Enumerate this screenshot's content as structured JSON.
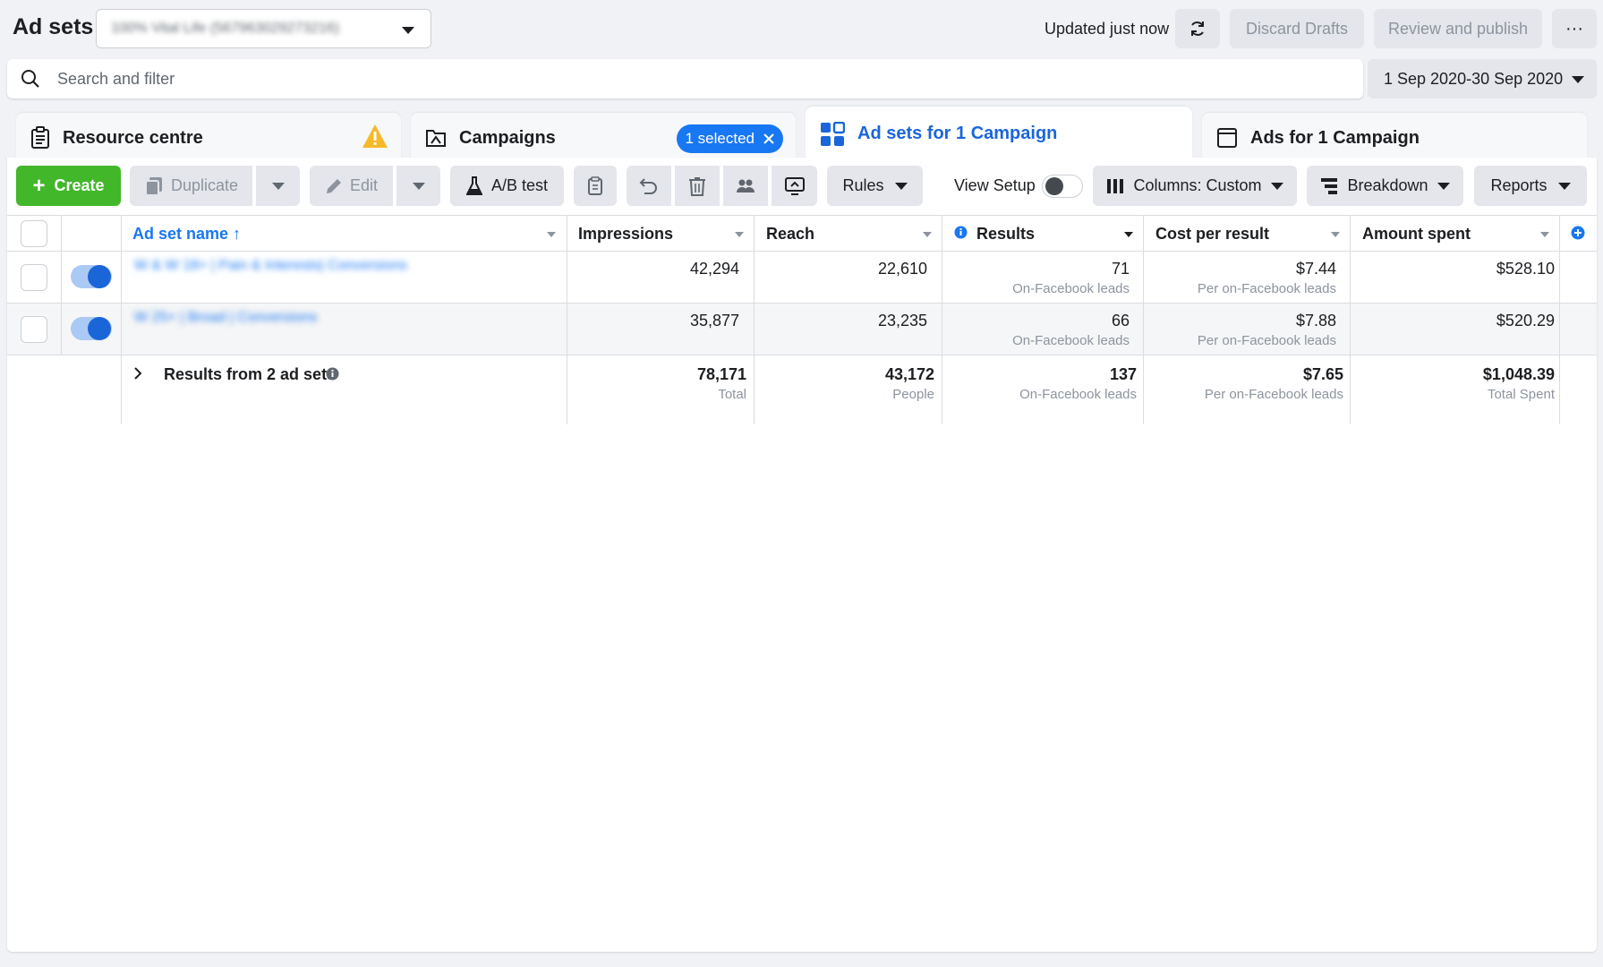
{
  "header": {
    "title": "Ad sets",
    "account_name": "100% Vital Life (567963029273216)",
    "updated_text": "Updated just now",
    "discard_label": "Discard Drafts",
    "publish_label": "Review and publish",
    "more_label": "···"
  },
  "search": {
    "placeholder": "Search and filter",
    "date_range": "1 Sep 2020-30 Sep 2020"
  },
  "tabs": [
    {
      "label": "Resource centre"
    },
    {
      "label": "Campaigns",
      "badge": "1 selected"
    },
    {
      "label": "Ad sets for 1 Campaign"
    },
    {
      "label": "Ads for 1 Campaign"
    }
  ],
  "toolbar": {
    "create": "Create",
    "duplicate": "Duplicate",
    "edit": "Edit",
    "ab_test": "A/B test",
    "rules": "Rules",
    "view_setup": "View Setup",
    "columns": "Columns: Custom",
    "breakdown": "Breakdown",
    "reports": "Reports"
  },
  "table": {
    "headers": {
      "name": "Ad set name ↑",
      "impressions": "Impressions",
      "reach": "Reach",
      "results": "Results",
      "cost_per_result": "Cost per result",
      "amount_spent": "Amount spent"
    },
    "rows": [
      {
        "name": "W & W 18+ | Pain & Interests| Conversions",
        "enabled": true,
        "impressions": "42,294",
        "reach": "22,610",
        "results": "71",
        "results_sub": "On-Facebook leads",
        "cost": "$7.44",
        "cost_sub": "Per on-Facebook leads",
        "spent": "$528.10"
      },
      {
        "name": "W 25+ | Broad | Conversions",
        "enabled": true,
        "impressions": "35,877",
        "reach": "23,235",
        "results": "66",
        "results_sub": "On-Facebook leads",
        "cost": "$7.88",
        "cost_sub": "Per on-Facebook leads",
        "spent": "$520.29"
      }
    ],
    "totals": {
      "label": "Results from 2 ad sets",
      "impressions": "78,171",
      "impressions_sub": "Total",
      "reach": "43,172",
      "reach_sub": "People",
      "results": "137",
      "results_sub": "On-Facebook leads",
      "cost": "$7.65",
      "cost_sub": "Per on-Facebook leads",
      "spent": "$1,048.39",
      "spent_sub": "Total Spent"
    }
  },
  "colors": {
    "accent": "#1877f2",
    "create_green": "#42b72a",
    "warning": "#f7b928"
  }
}
